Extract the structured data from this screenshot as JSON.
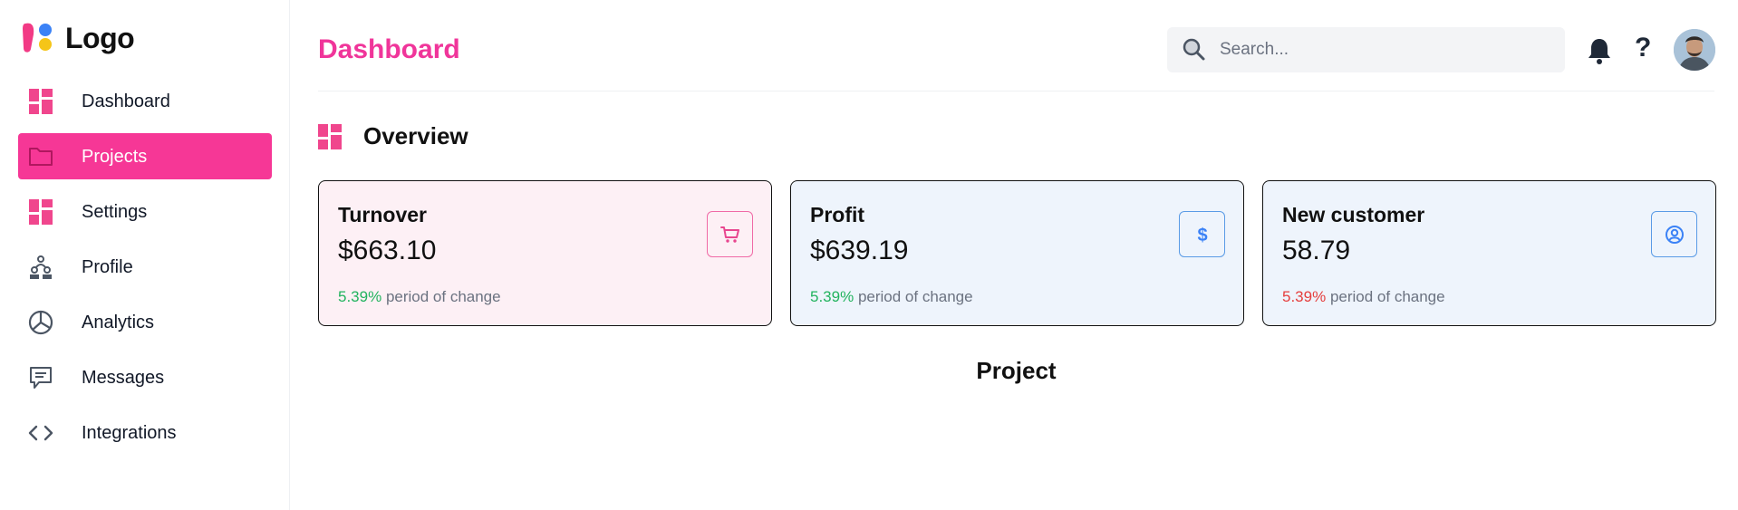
{
  "brand": {
    "logo_text": "Logo"
  },
  "sidebar": {
    "items": [
      {
        "label": "Dashboard",
        "icon": "dashboard-grid-icon",
        "active": false
      },
      {
        "label": "Projects",
        "icon": "folder-icon",
        "active": true
      },
      {
        "label": "Settings",
        "icon": "settings-grid-icon",
        "active": false
      },
      {
        "label": "Profile",
        "icon": "people-icon",
        "active": false
      },
      {
        "label": "Analytics",
        "icon": "pie-chart-icon",
        "active": false
      },
      {
        "label": "Messages",
        "icon": "chat-icon",
        "active": false
      },
      {
        "label": "Integrations",
        "icon": "code-icon",
        "active": false
      }
    ]
  },
  "header": {
    "title": "Dashboard",
    "search": {
      "placeholder": "Search...",
      "value": ""
    },
    "help_label": "?",
    "icons": [
      "search-icon",
      "bell-icon",
      "help-icon",
      "avatar"
    ]
  },
  "overview": {
    "title": "Overview",
    "cards": [
      {
        "title": "Turnover",
        "value": "$663.10",
        "change_pct": "5.39%",
        "change_label": "period of change",
        "trend": "up",
        "icon": "cart-icon"
      },
      {
        "title": "Profit",
        "value": "$639.19",
        "change_pct": "5.39%",
        "change_label": "period of change",
        "trend": "up",
        "icon": "dollar-icon"
      },
      {
        "title": "New customer",
        "value": "58.79",
        "change_pct": "5.39%",
        "change_label": "period of change",
        "trend": "down",
        "icon": "user-circle-icon"
      }
    ]
  },
  "project": {
    "title": "Project"
  },
  "colors": {
    "accent": "#f63796",
    "title_pink": "#f0359a",
    "positive": "#22b35e",
    "negative": "#e53e3e",
    "card_pink_bg": "#fdf0f5",
    "card_blue_bg": "#eef4fc",
    "icon_blue": "#3b82f6"
  }
}
